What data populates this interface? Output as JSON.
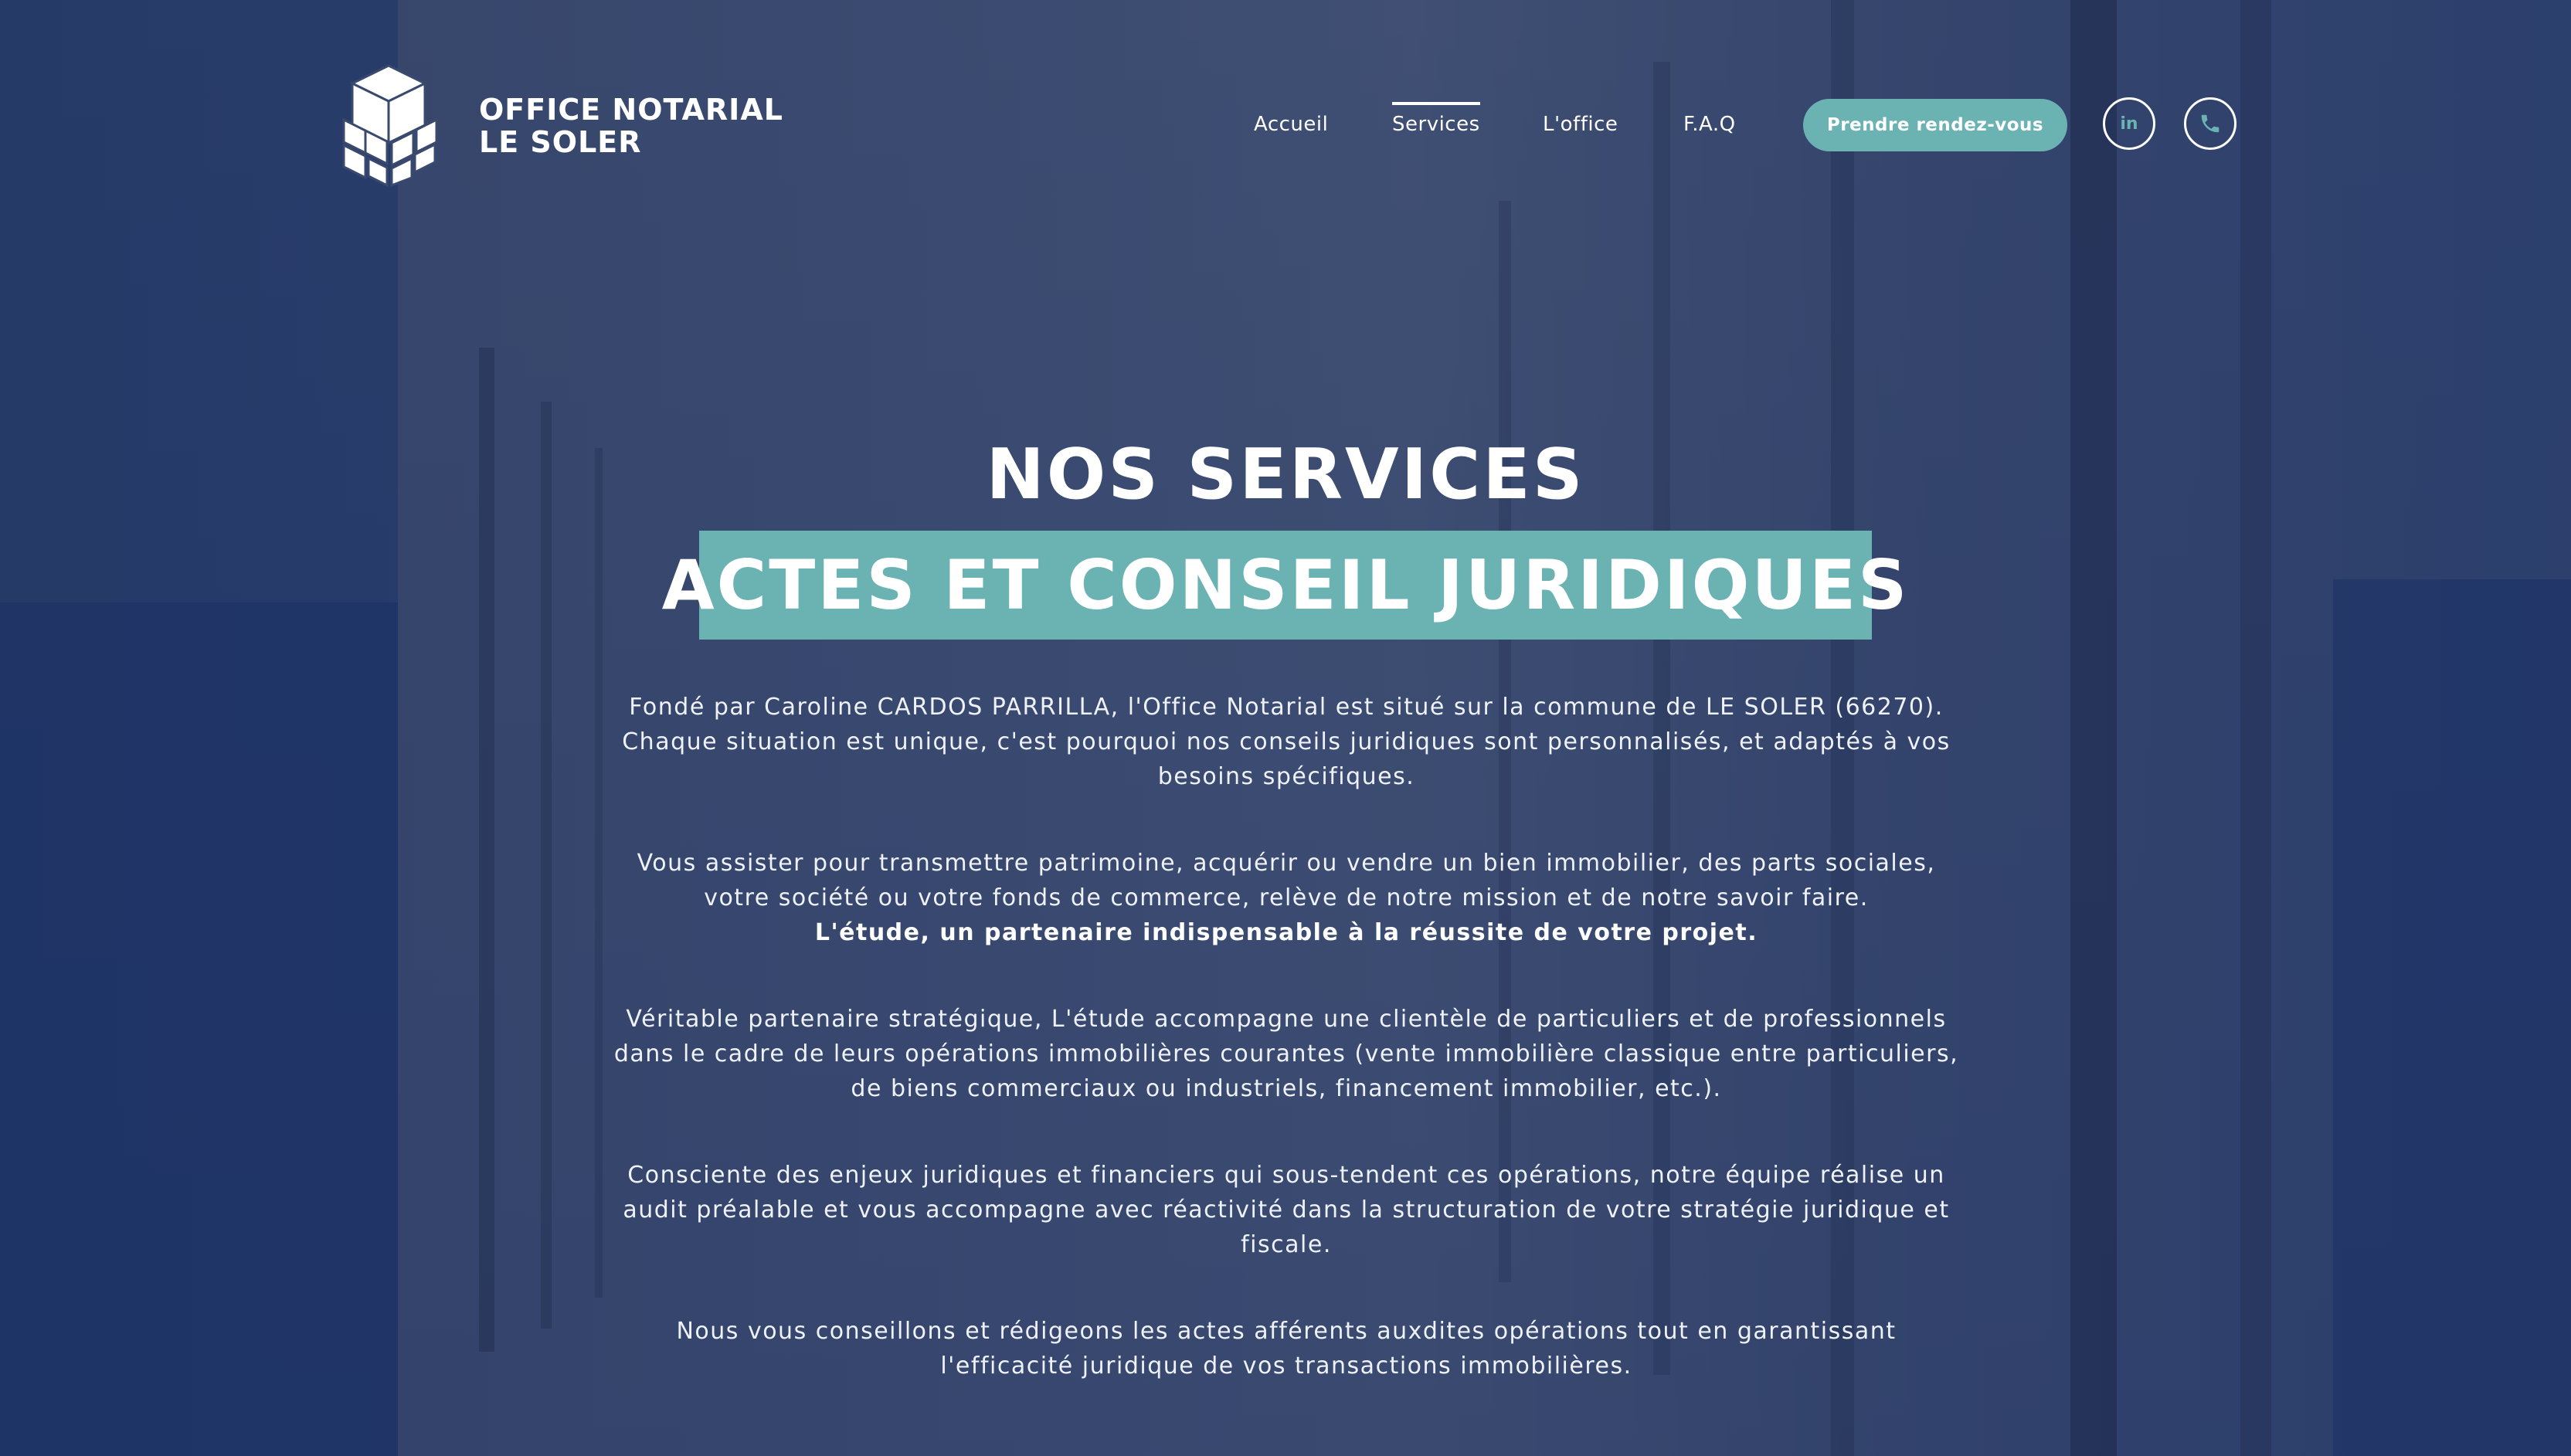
{
  "brand": {
    "line1": "OFFICE NOTARIAL",
    "line2": "LE SOLER",
    "logo_icon": "cube-logo-icon"
  },
  "nav": {
    "items": [
      {
        "label": "Accueil"
      },
      {
        "label": "Services",
        "active": true
      },
      {
        "label": "L'office"
      },
      {
        "label": "F.A.Q"
      }
    ],
    "cta_label": "Prendre rendez-vous",
    "linkedin_label": "in",
    "linkedin_icon": "linkedin-icon",
    "phone_icon": "phone-icon"
  },
  "colors": {
    "accent": "#6bb3b3",
    "background": "#3a4a6e",
    "text": "#ffffff"
  },
  "hero": {
    "title": "NOS SERVICES",
    "subtitle": "ACTES ET CONSEIL JURIDIQUES"
  },
  "content": {
    "p1": "Fondé par Caroline CARDOS PARRILLA, l'Office Notarial est situé sur la commune de LE SOLER (66270). Chaque situation est unique, c'est pourquoi nos conseils juridiques sont personnalisés, et adaptés à vos besoins spécifiques.",
    "p2": "Vous assister pour transmettre patrimoine, acquérir ou vendre un bien immobilier, des parts sociales, votre société ou votre fonds de commerce, relève de notre mission et de notre savoir faire.",
    "p2_strong": "L'étude, un partenaire indispensable à la réussite de votre projet.",
    "p3": "Véritable partenaire stratégique, L'étude accompagne une clientèle de particuliers et de professionnels dans le cadre de leurs opérations immobilières courantes (vente immobilière classique entre particuliers, de biens commerciaux ou industriels, financement immobilier, etc.).",
    "p4": "Consciente des enjeux juridiques et financiers qui sous-tendent ces opérations, notre équipe réalise un audit préalable et vous accompagne avec réactivité dans la structuration de votre stratégie juridique et fiscale.",
    "p5": "Nous vous conseillons et rédigeons les actes afférents auxdites opérations tout en garantissant l'efficacité juridique de vos transactions immobilières."
  }
}
